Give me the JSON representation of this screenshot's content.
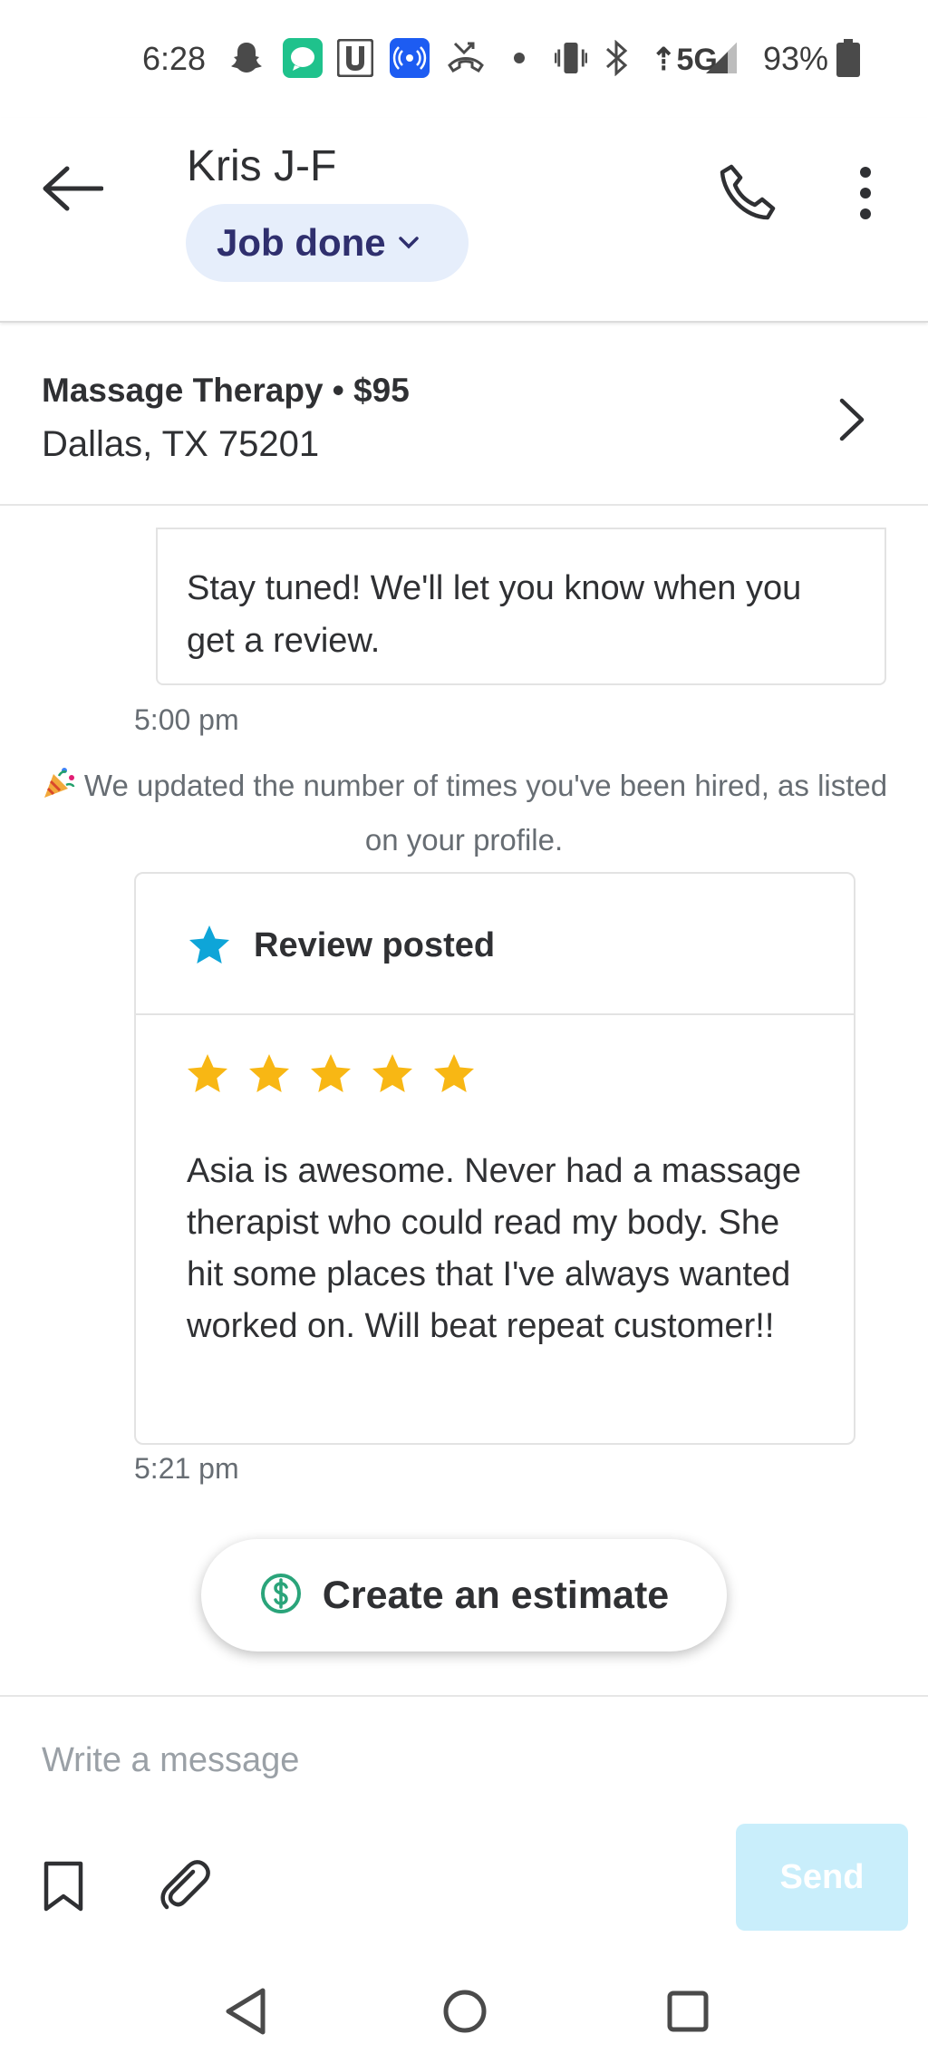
{
  "status_bar": {
    "time": "6:28",
    "network": "5G",
    "battery": "93%",
    "icons": [
      "snapchat-icon",
      "messages-icon",
      "u-app-icon",
      "broadcast-icon",
      "missed-call-icon",
      "dot-icon",
      "vibrate-icon",
      "bluetooth-icon",
      "signal-icon",
      "battery-icon"
    ]
  },
  "header": {
    "contact_name": "Kris J-F",
    "status_label": "Job done",
    "icons": [
      "back-arrow-icon",
      "phone-icon",
      "more-vertical-icon",
      "chevron-down-icon"
    ]
  },
  "job": {
    "title": "Massage Therapy • $95",
    "location": "Dallas, TX 75201"
  },
  "chat": {
    "prev_message": "Stay tuned! We'll let you know when you get a review.",
    "prev_time": "5:00 pm",
    "system_note": "We updated the number of times you've been hired, as listed on your profile.",
    "review": {
      "heading": "Review posted",
      "rating": 5,
      "max_rating": 5,
      "text": "Asia is awesome. Never had a massage therapist who could read my body. She hit some places that I've always wanted worked on. Will beat repeat customer!!",
      "time": "5:21 pm"
    },
    "estimate_button": "Create an estimate"
  },
  "composer": {
    "placeholder": "Write a message",
    "send_label": "Send"
  },
  "colors": {
    "accent_blue": "#0ea5d8",
    "star_yellow": "#f8b714",
    "pill_bg": "#e6eefb",
    "pill_text": "#2f2f6e",
    "send_disabled": "#c9eefb",
    "estimate_green": "#2aa47a"
  }
}
